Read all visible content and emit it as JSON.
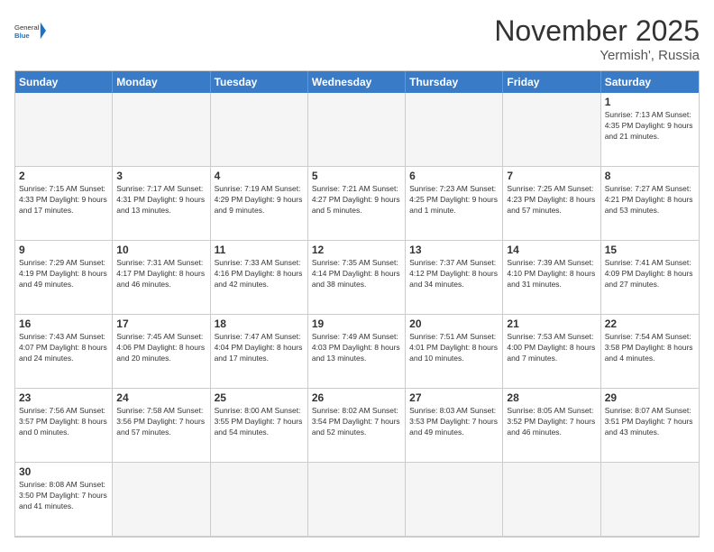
{
  "header": {
    "logo_general": "General",
    "logo_blue": "Blue",
    "month": "November 2025",
    "location": "Yermish', Russia"
  },
  "days_of_week": [
    "Sunday",
    "Monday",
    "Tuesday",
    "Wednesday",
    "Thursday",
    "Friday",
    "Saturday"
  ],
  "cells": [
    {
      "day": "",
      "empty": true,
      "info": ""
    },
    {
      "day": "",
      "empty": true,
      "info": ""
    },
    {
      "day": "",
      "empty": true,
      "info": ""
    },
    {
      "day": "",
      "empty": true,
      "info": ""
    },
    {
      "day": "",
      "empty": true,
      "info": ""
    },
    {
      "day": "",
      "empty": true,
      "info": ""
    },
    {
      "day": "1",
      "empty": false,
      "info": "Sunrise: 7:13 AM\nSunset: 4:35 PM\nDaylight: 9 hours and 21 minutes."
    },
    {
      "day": "2",
      "empty": false,
      "info": "Sunrise: 7:15 AM\nSunset: 4:33 PM\nDaylight: 9 hours and 17 minutes."
    },
    {
      "day": "3",
      "empty": false,
      "info": "Sunrise: 7:17 AM\nSunset: 4:31 PM\nDaylight: 9 hours and 13 minutes."
    },
    {
      "day": "4",
      "empty": false,
      "info": "Sunrise: 7:19 AM\nSunset: 4:29 PM\nDaylight: 9 hours and 9 minutes."
    },
    {
      "day": "5",
      "empty": false,
      "info": "Sunrise: 7:21 AM\nSunset: 4:27 PM\nDaylight: 9 hours and 5 minutes."
    },
    {
      "day": "6",
      "empty": false,
      "info": "Sunrise: 7:23 AM\nSunset: 4:25 PM\nDaylight: 9 hours and 1 minute."
    },
    {
      "day": "7",
      "empty": false,
      "info": "Sunrise: 7:25 AM\nSunset: 4:23 PM\nDaylight: 8 hours and 57 minutes."
    },
    {
      "day": "8",
      "empty": false,
      "info": "Sunrise: 7:27 AM\nSunset: 4:21 PM\nDaylight: 8 hours and 53 minutes."
    },
    {
      "day": "9",
      "empty": false,
      "info": "Sunrise: 7:29 AM\nSunset: 4:19 PM\nDaylight: 8 hours and 49 minutes."
    },
    {
      "day": "10",
      "empty": false,
      "info": "Sunrise: 7:31 AM\nSunset: 4:17 PM\nDaylight: 8 hours and 46 minutes."
    },
    {
      "day": "11",
      "empty": false,
      "info": "Sunrise: 7:33 AM\nSunset: 4:16 PM\nDaylight: 8 hours and 42 minutes."
    },
    {
      "day": "12",
      "empty": false,
      "info": "Sunrise: 7:35 AM\nSunset: 4:14 PM\nDaylight: 8 hours and 38 minutes."
    },
    {
      "day": "13",
      "empty": false,
      "info": "Sunrise: 7:37 AM\nSunset: 4:12 PM\nDaylight: 8 hours and 34 minutes."
    },
    {
      "day": "14",
      "empty": false,
      "info": "Sunrise: 7:39 AM\nSunset: 4:10 PM\nDaylight: 8 hours and 31 minutes."
    },
    {
      "day": "15",
      "empty": false,
      "info": "Sunrise: 7:41 AM\nSunset: 4:09 PM\nDaylight: 8 hours and 27 minutes."
    },
    {
      "day": "16",
      "empty": false,
      "info": "Sunrise: 7:43 AM\nSunset: 4:07 PM\nDaylight: 8 hours and 24 minutes."
    },
    {
      "day": "17",
      "empty": false,
      "info": "Sunrise: 7:45 AM\nSunset: 4:06 PM\nDaylight: 8 hours and 20 minutes."
    },
    {
      "day": "18",
      "empty": false,
      "info": "Sunrise: 7:47 AM\nSunset: 4:04 PM\nDaylight: 8 hours and 17 minutes."
    },
    {
      "day": "19",
      "empty": false,
      "info": "Sunrise: 7:49 AM\nSunset: 4:03 PM\nDaylight: 8 hours and 13 minutes."
    },
    {
      "day": "20",
      "empty": false,
      "info": "Sunrise: 7:51 AM\nSunset: 4:01 PM\nDaylight: 8 hours and 10 minutes."
    },
    {
      "day": "21",
      "empty": false,
      "info": "Sunrise: 7:53 AM\nSunset: 4:00 PM\nDaylight: 8 hours and 7 minutes."
    },
    {
      "day": "22",
      "empty": false,
      "info": "Sunrise: 7:54 AM\nSunset: 3:58 PM\nDaylight: 8 hours and 4 minutes."
    },
    {
      "day": "23",
      "empty": false,
      "info": "Sunrise: 7:56 AM\nSunset: 3:57 PM\nDaylight: 8 hours and 0 minutes."
    },
    {
      "day": "24",
      "empty": false,
      "info": "Sunrise: 7:58 AM\nSunset: 3:56 PM\nDaylight: 7 hours and 57 minutes."
    },
    {
      "day": "25",
      "empty": false,
      "info": "Sunrise: 8:00 AM\nSunset: 3:55 PM\nDaylight: 7 hours and 54 minutes."
    },
    {
      "day": "26",
      "empty": false,
      "info": "Sunrise: 8:02 AM\nSunset: 3:54 PM\nDaylight: 7 hours and 52 minutes."
    },
    {
      "day": "27",
      "empty": false,
      "info": "Sunrise: 8:03 AM\nSunset: 3:53 PM\nDaylight: 7 hours and 49 minutes."
    },
    {
      "day": "28",
      "empty": false,
      "info": "Sunrise: 8:05 AM\nSunset: 3:52 PM\nDaylight: 7 hours and 46 minutes."
    },
    {
      "day": "29",
      "empty": false,
      "info": "Sunrise: 8:07 AM\nSunset: 3:51 PM\nDaylight: 7 hours and 43 minutes."
    },
    {
      "day": "30",
      "empty": false,
      "info": "Sunrise: 8:08 AM\nSunset: 3:50 PM\nDaylight: 7 hours and 41 minutes."
    },
    {
      "day": "",
      "empty": true,
      "info": ""
    },
    {
      "day": "",
      "empty": true,
      "info": ""
    },
    {
      "day": "",
      "empty": true,
      "info": ""
    },
    {
      "day": "",
      "empty": true,
      "info": ""
    },
    {
      "day": "",
      "empty": true,
      "info": ""
    },
    {
      "day": "",
      "empty": true,
      "info": ""
    }
  ]
}
